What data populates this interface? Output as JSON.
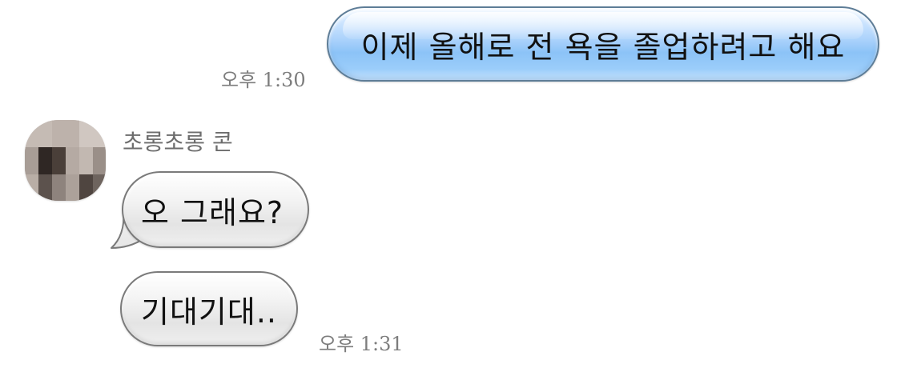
{
  "conversation": {
    "messages": [
      {
        "direction": "outgoing",
        "text": "이제 올해로 전 욕을 졸업하려고 해요",
        "time": "오후 1:30"
      },
      {
        "direction": "incoming",
        "sender": "초롱초롱 콘",
        "text": "오 그래요?"
      },
      {
        "direction": "incoming",
        "text": "기대기대..",
        "time": "오후 1:31"
      }
    ]
  },
  "avatar": {
    "icon": "pixelated-avatar-icon",
    "colors": [
      "#b9aea6",
      "#c5bbb4",
      "#a89d96",
      "#4a3f39",
      "#2f2724",
      "#8e837d",
      "#d0c7c1",
      "#5c524d",
      "#9a8f88"
    ]
  },
  "theme": {
    "outgoing_bubble": "#9bcdfa",
    "incoming_bubble": "#ececec",
    "timestamp_color": "#7d7d7d"
  }
}
